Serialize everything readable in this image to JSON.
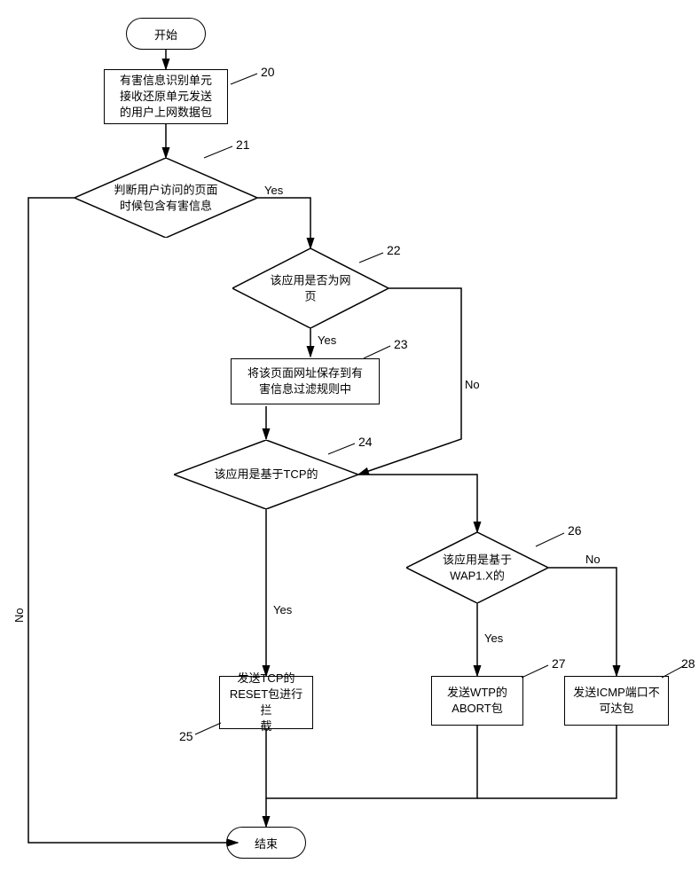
{
  "terminator": {
    "start": "开始",
    "end": "结束"
  },
  "nodes": {
    "p20": "有害信息识别单元\n接收还原单元发送\n的用户上网数据包",
    "d21": "判断用户访问的页面\n时候包含有害信息",
    "d22": "该应用是否为网\n页",
    "p23": "将该页面网址保存到有\n害信息过滤规则中",
    "d24": "该应用是基于TCP的",
    "p25": "发送TCP的\nRESET包进行拦\n截",
    "d26": "该应用是基于\nWAP1.X的",
    "p27": "发送WTP的\nABORT包",
    "p28": "发送ICMP端口不\n可达包"
  },
  "callouts": {
    "c20": "20",
    "c21": "21",
    "c22": "22",
    "c23": "23",
    "c24": "24",
    "c25": "25",
    "c26": "26",
    "c27": "27",
    "c28": "28"
  },
  "labels": {
    "yes": "Yes",
    "no": "No"
  }
}
